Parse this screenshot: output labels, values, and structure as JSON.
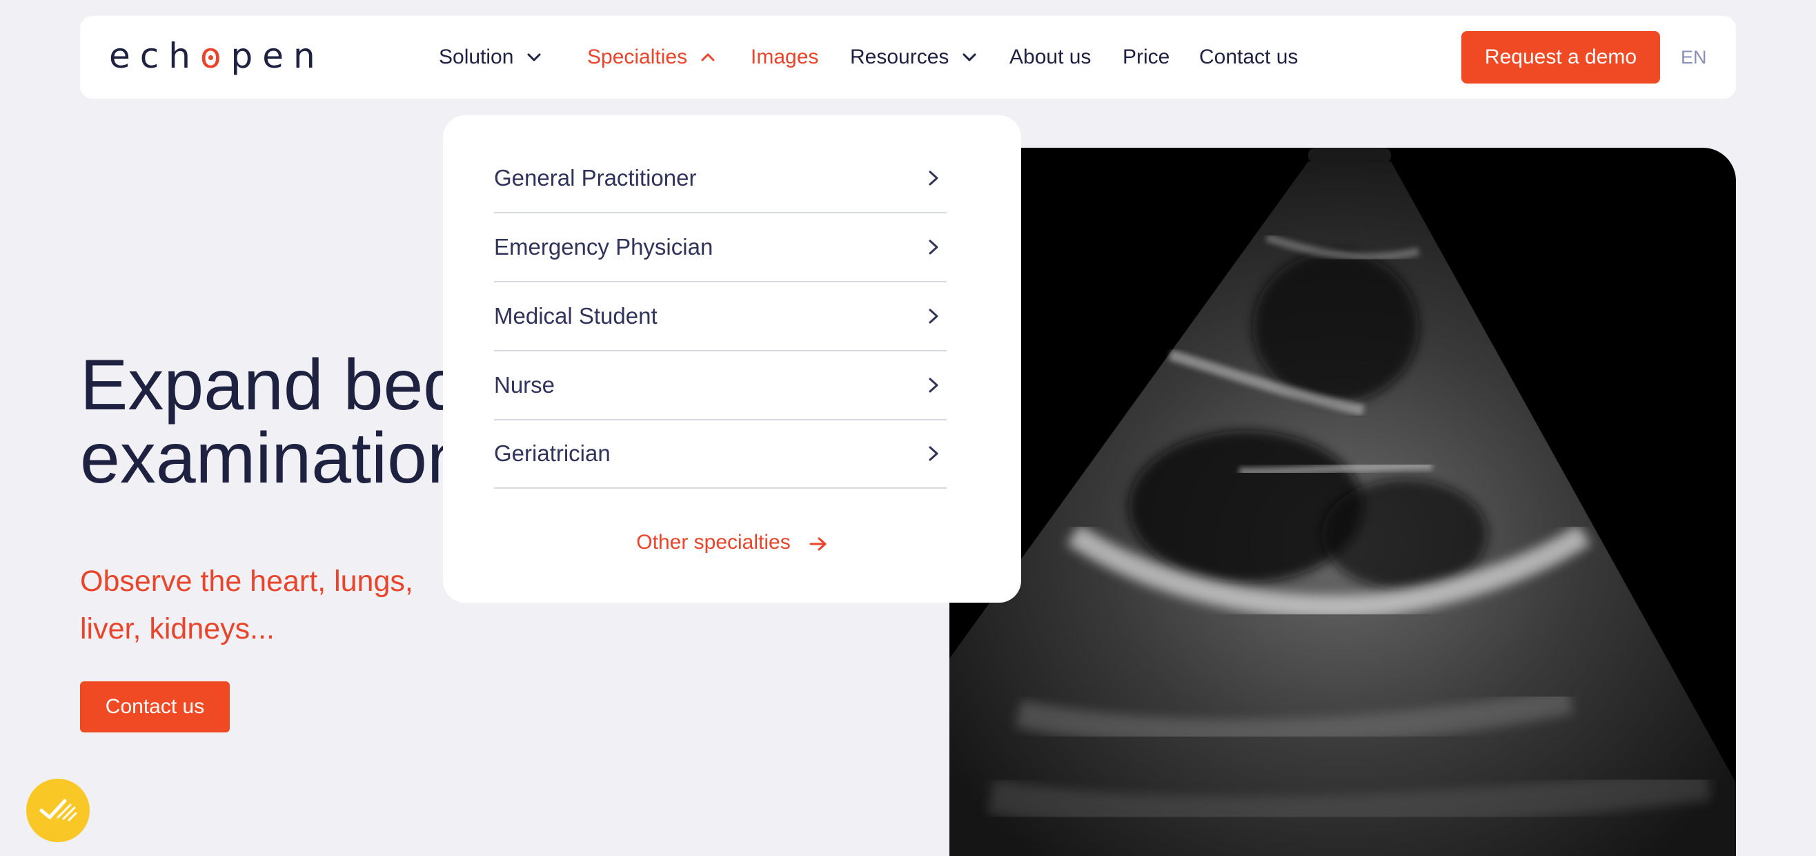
{
  "header": {
    "logo_text": "echopen",
    "nav": [
      {
        "label": "Solution",
        "has_dropdown": true
      },
      {
        "label": "Specialties",
        "has_dropdown": true,
        "active": true
      },
      {
        "label": "Images",
        "has_dropdown": false
      },
      {
        "label": "Resources",
        "has_dropdown": true
      },
      {
        "label": "About us",
        "has_dropdown": false
      },
      {
        "label": "Price",
        "has_dropdown": false
      },
      {
        "label": "Contact us",
        "has_dropdown": false
      }
    ],
    "demo_button": "Request a demo",
    "language": "EN"
  },
  "dropdown": {
    "items": [
      {
        "label": "General Practitioner",
        "icon": "chevron-right-icon"
      },
      {
        "label": "Emergency Physician",
        "icon": "chevron-right-icon"
      },
      {
        "label": "Medical Student",
        "icon": "chevron-right-icon"
      },
      {
        "label": "Nurse",
        "icon": "chevron-right-icon"
      },
      {
        "label": "Geriatrician",
        "icon": "chevron-right-icon"
      }
    ],
    "other_link": "Other specialties",
    "other_icon": "arrow-right-icon"
  },
  "hero": {
    "title_line1": "Expand beds",
    "title_line2": "examination",
    "subtitle_line1": "Observe the heart, lungs,",
    "subtitle_line2": "liver, kidneys...",
    "cta": "Contact us"
  },
  "image": {
    "type": "ultrasound scan",
    "icon": "ultrasound-image"
  },
  "cookie_badge": {
    "icon": "cookie-consent-check-icon"
  },
  "colors": {
    "accent": "#f04a24",
    "accent_text": "#e8452c",
    "page_bg": "#f1f0f5",
    "text_dark": "#1e2140",
    "badge_yellow": "#f9c826"
  }
}
